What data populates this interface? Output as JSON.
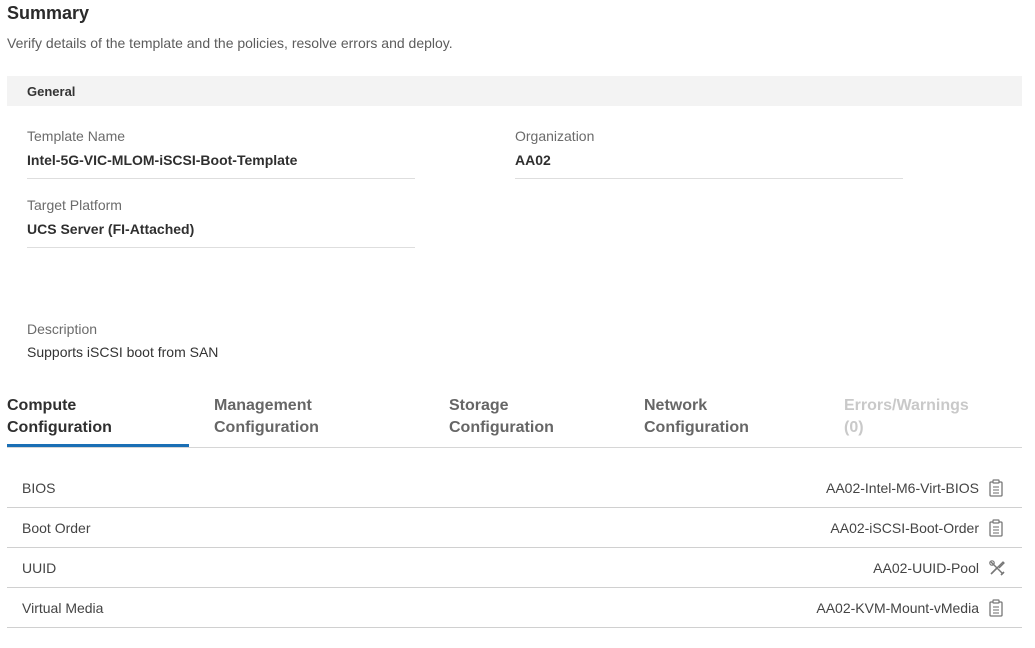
{
  "header": {
    "title": "Summary",
    "subtitle": "Verify details of the template and the policies, resolve errors and deploy."
  },
  "general": {
    "section_label": "General",
    "template_name_label": "Template Name",
    "template_name_value": "Intel-5G-VIC-MLOM-iSCSI-Boot-Template",
    "organization_label": "Organization",
    "organization_value": "AA02",
    "target_platform_label": "Target Platform",
    "target_platform_value": "UCS Server (FI-Attached)",
    "description_label": "Description",
    "description_value": "Supports iSCSI boot from SAN"
  },
  "tabs": {
    "compute_l1": "Compute",
    "compute_l2": "Configuration",
    "management_l1": "Management",
    "management_l2": "Configuration",
    "storage_l1": "Storage",
    "storage_l2": "Configuration",
    "network_l1": "Network",
    "network_l2": "Configuration",
    "errors_l1": "Errors/Warnings",
    "errors_l2": "(0)"
  },
  "policies": [
    {
      "label": "BIOS",
      "value": "AA02-Intel-M6-Virt-BIOS",
      "icon": "clipboard-icon"
    },
    {
      "label": "Boot Order",
      "value": "AA02-iSCSI-Boot-Order",
      "icon": "clipboard-icon"
    },
    {
      "label": "UUID",
      "value": "AA02-UUID-Pool",
      "icon": "tools-icon"
    },
    {
      "label": "Virtual Media",
      "value": "AA02-KVM-Mount-vMedia",
      "icon": "clipboard-icon"
    }
  ],
  "colors": {
    "accent": "#1a6fb5",
    "section_bg": "#f3f3f3",
    "disabled_text": "#c9c9c9"
  }
}
